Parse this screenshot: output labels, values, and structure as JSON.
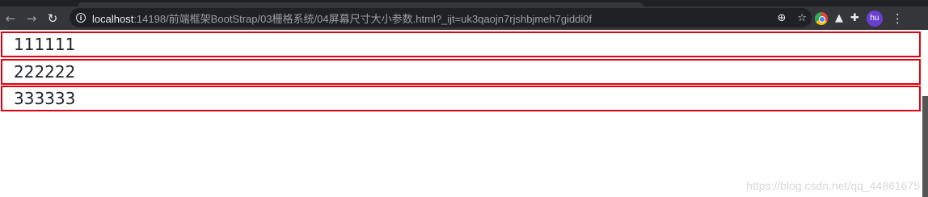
{
  "browser": {
    "url_host": "localhost",
    "url_rest": ":14198/前端框架BootStrap/03栅格系统/04屏幕尺寸大小参数.html?_ijt=uk3qaojn7rjshbjmeh7giddi0f",
    "avatar_text": "hu",
    "icons": {
      "back": "back-arrow-icon",
      "forward": "forward-arrow-icon",
      "reload": "reload-icon",
      "info": "info-icon",
      "zoom": "zoom-icon",
      "bookmark": "star-icon",
      "extensions": [
        "chrome-extension-icon",
        "mountain-extension-icon",
        "puzzle-extension-icon"
      ],
      "menu": "kebab-menu-icon"
    }
  },
  "page": {
    "rows": [
      "111111",
      "222222",
      "333333"
    ],
    "row_border_color": "#e1000f"
  },
  "watermark": "https://blog.csdn.net/qq_44861675"
}
